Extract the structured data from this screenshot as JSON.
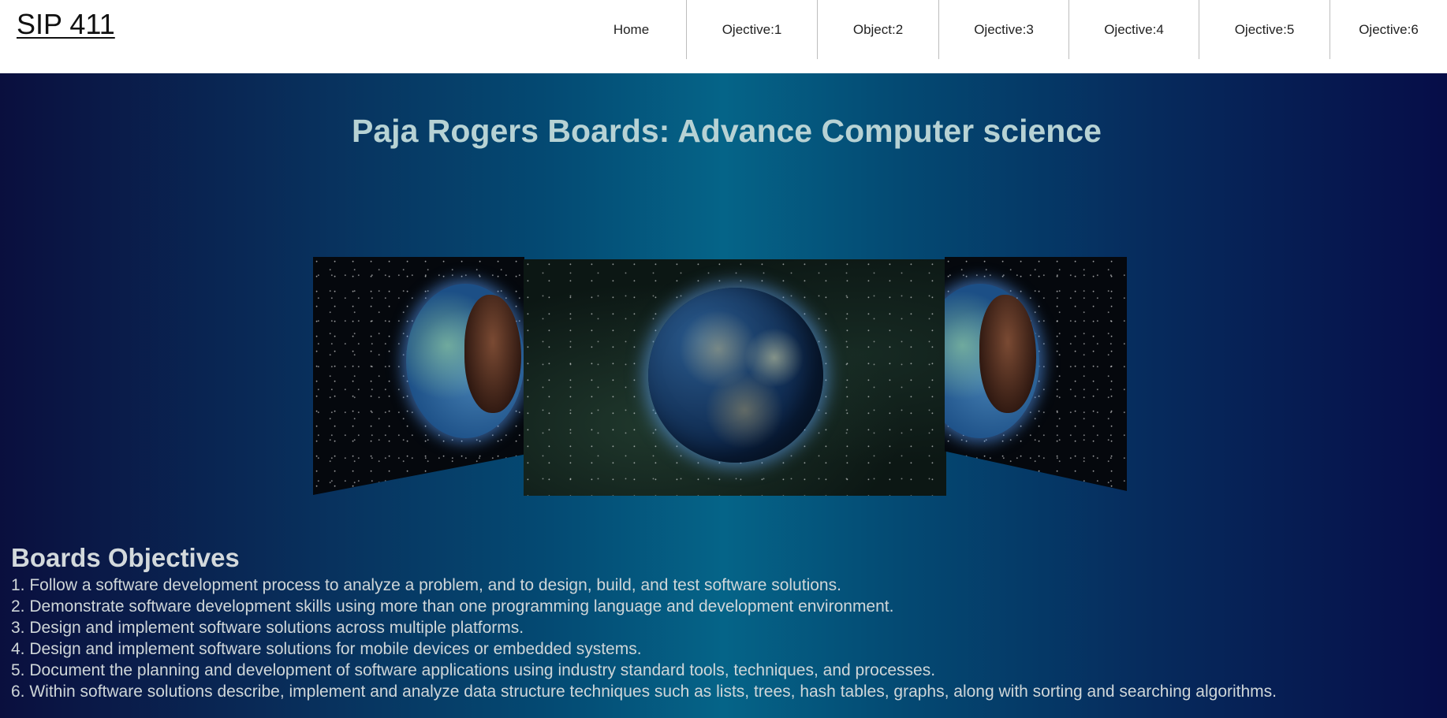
{
  "header": {
    "logo": "SIP 411",
    "nav": [
      {
        "label": "Home"
      },
      {
        "label": "Ojective:1"
      },
      {
        "label": "Object:2"
      },
      {
        "label": "Ojective:3"
      },
      {
        "label": "Ojective:4"
      },
      {
        "label": "Ojective:5"
      },
      {
        "label": "Ojective:6"
      }
    ]
  },
  "main": {
    "title": "Paja Rogers Boards: Advance Computer science",
    "carousel": {
      "slides": [
        {
          "image": "earth-with-woman-profile",
          "position": "left"
        },
        {
          "image": "earth-from-space-night-lights",
          "position": "center"
        },
        {
          "image": "earth-with-woman-profile",
          "position": "right"
        }
      ]
    },
    "objectives": {
      "heading": "Boards Objectives",
      "items": [
        "1. Follow a software development process to analyze a problem, and to design, build, and test software solutions.",
        "2. Demonstrate software development skills using more than one programming language and development environment.",
        "3. Design and implement software solutions across multiple platforms.",
        "4. Design and implement software solutions for mobile devices or embedded systems.",
        "5. Document the planning and development of software applications using industry standard tools, techniques, and processes.",
        "6. Within software solutions describe, implement and analyze data structure techniques such as lists, trees, hash tables, graphs, along with sorting and searching algorithms."
      ]
    }
  },
  "colors": {
    "title": "#b7d2d4",
    "text": "#cfd6d8",
    "background_dark": "#0a0f3e",
    "background_center": "#056488"
  }
}
